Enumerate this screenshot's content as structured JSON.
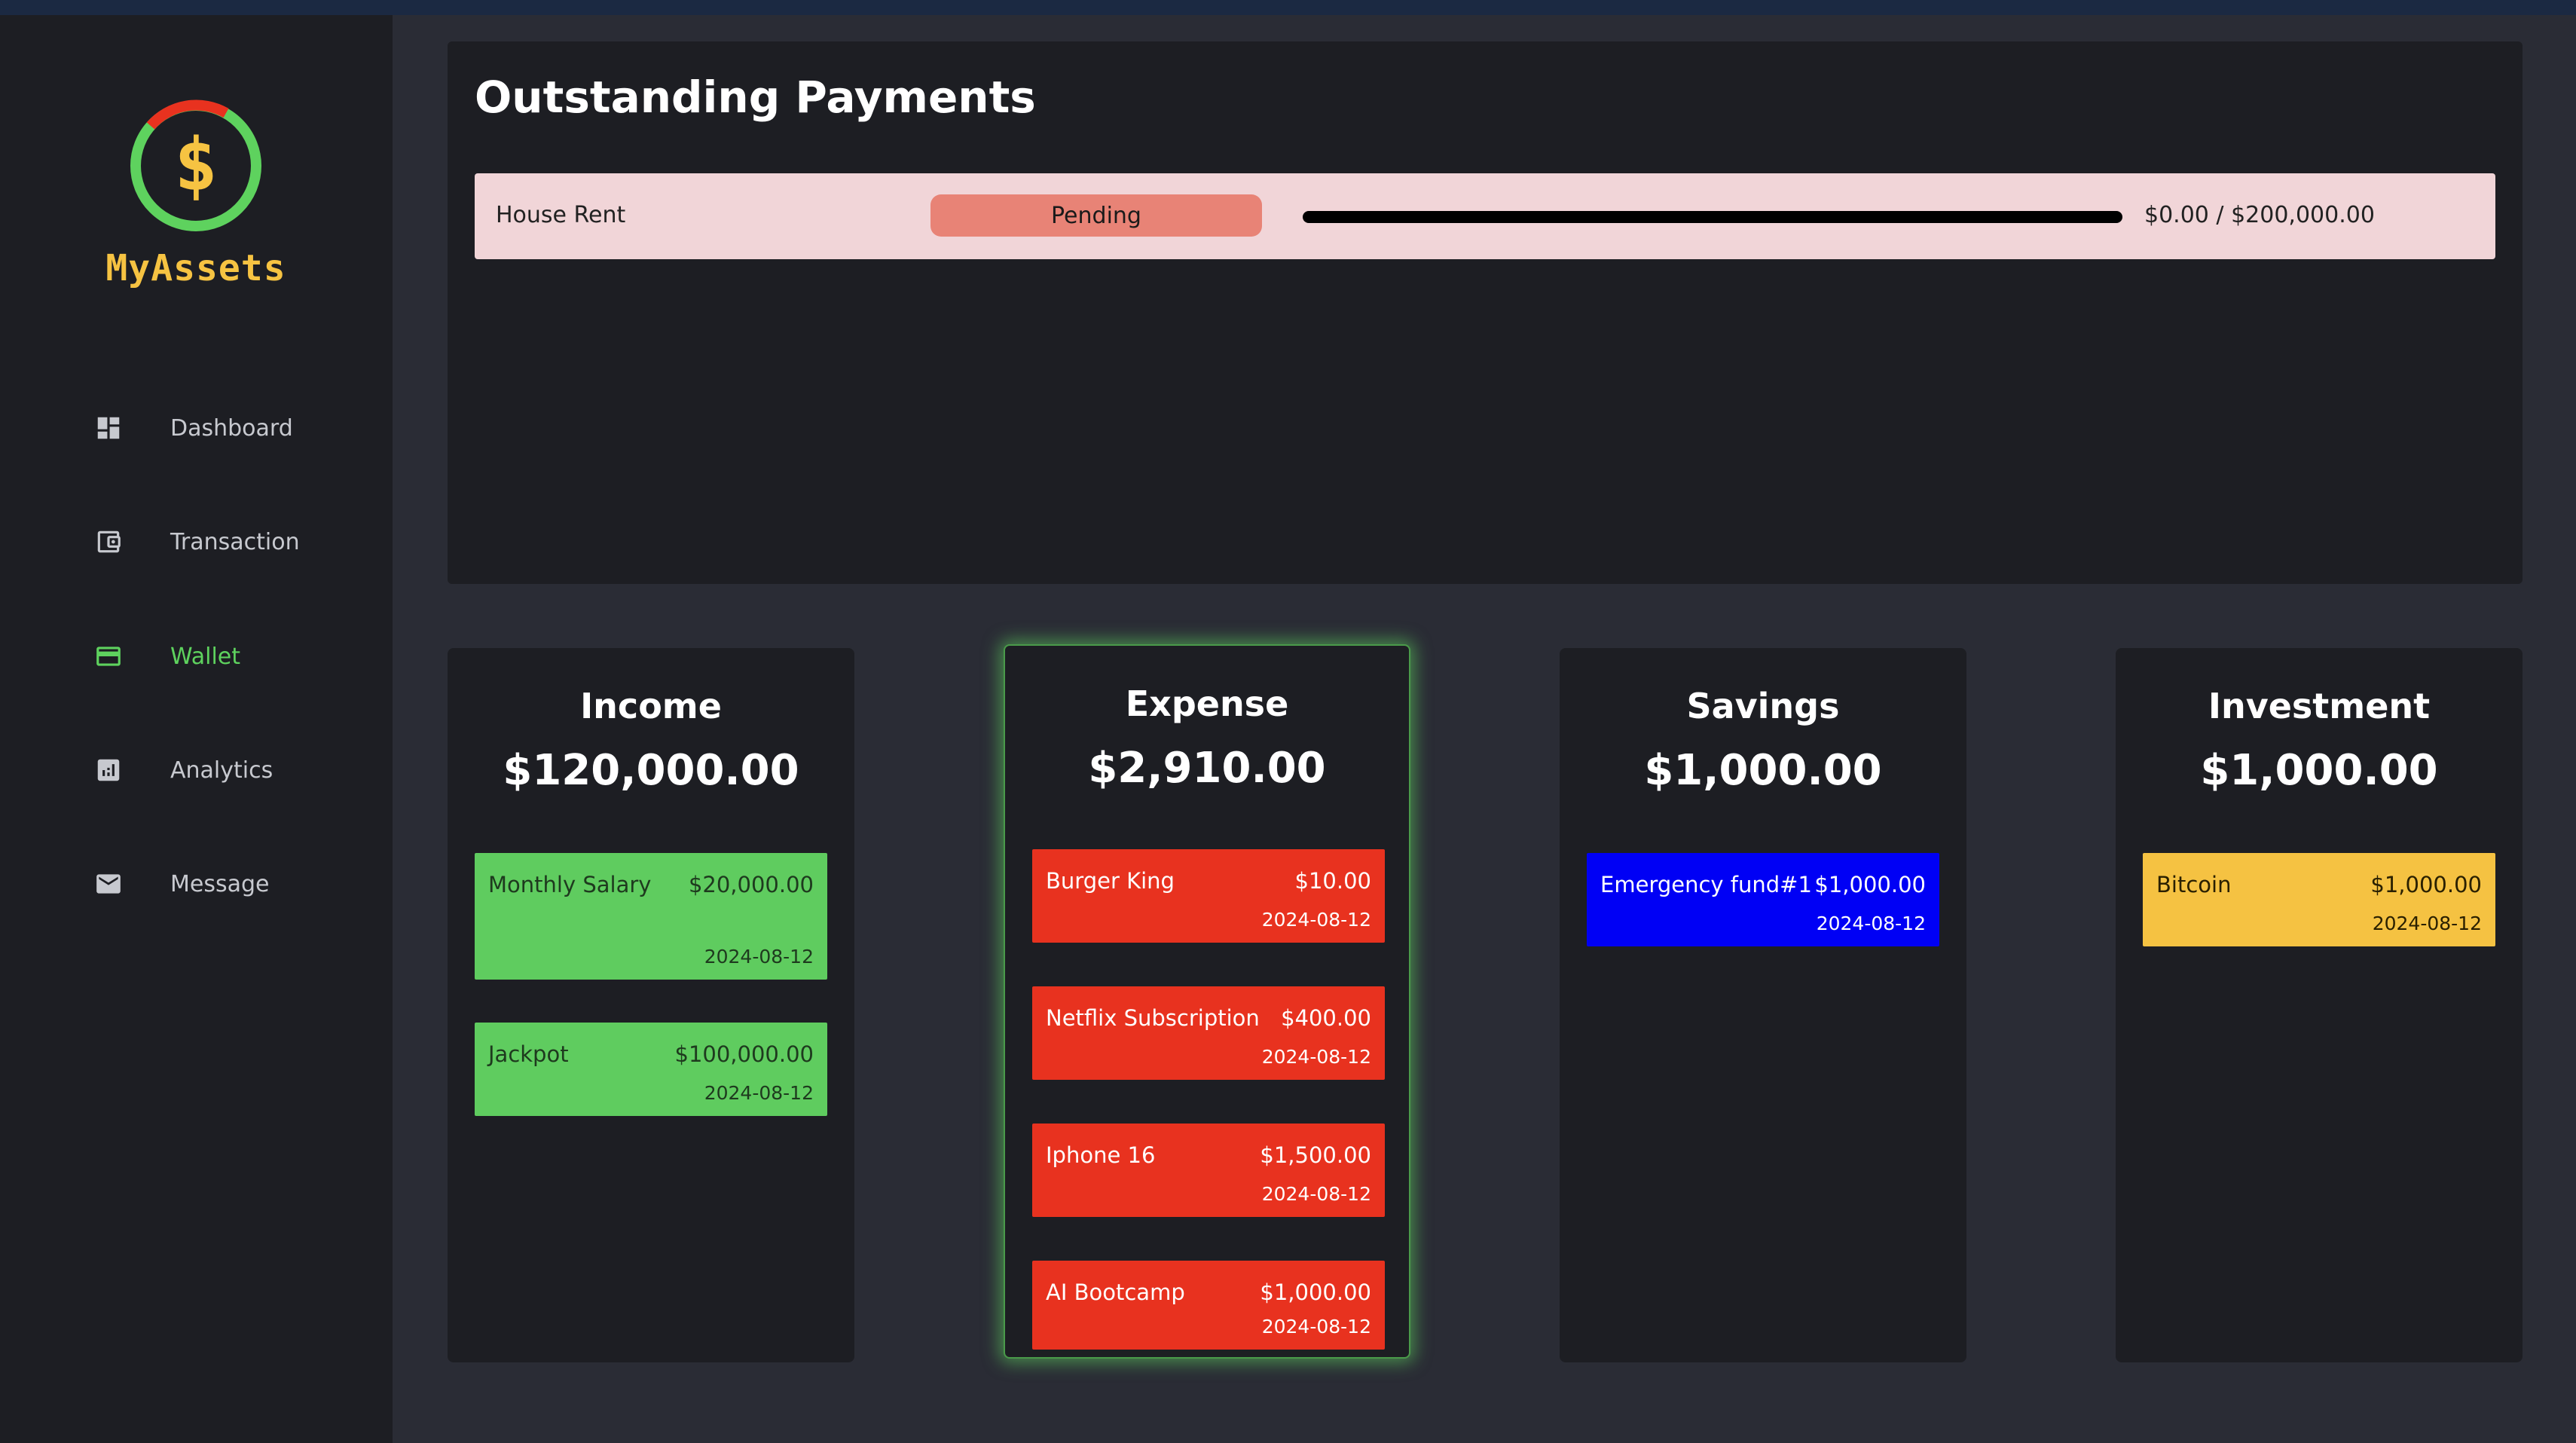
{
  "app": {
    "name": "MyAssets"
  },
  "colors": {
    "accent": "#5ed25e",
    "logo_gold": "#f6c342",
    "income": "#5fcc5f",
    "expense": "#e8321f",
    "savings": "#0000f5",
    "investment": "#f5c242",
    "pending": "#e88376"
  },
  "sidebar": {
    "items": [
      {
        "label": "Dashboard",
        "icon": "dashboard-icon",
        "active": false
      },
      {
        "label": "Transaction",
        "icon": "wallet-card-icon",
        "active": false
      },
      {
        "label": "Wallet",
        "icon": "credit-card-icon",
        "active": true
      },
      {
        "label": "Analytics",
        "icon": "bar-chart-icon",
        "active": false
      },
      {
        "label": "Message",
        "icon": "envelope-icon",
        "active": false
      }
    ]
  },
  "outstanding": {
    "title": "Outstanding Payments",
    "payments": [
      {
        "name": "House Rent",
        "status": "Pending",
        "amount_text": "$0.00 / $200,000.00",
        "progress_percent": 0
      }
    ]
  },
  "columns": {
    "income": {
      "title": "Income",
      "total": "$120,000.00",
      "items": [
        {
          "name": "Monthly Salary",
          "amount": "$20,000.00",
          "date": "2024-08-12"
        },
        {
          "name": "Jackpot",
          "amount": "$100,000.00",
          "date": "2024-08-12"
        }
      ]
    },
    "expense": {
      "title": "Expense",
      "total": "$2,910.00",
      "items": [
        {
          "name": "Burger King",
          "amount": "$10.00",
          "date": "2024-08-12"
        },
        {
          "name": "Netflix Subscription",
          "amount": "$400.00",
          "date": "2024-08-12"
        },
        {
          "name": "Iphone 16",
          "amount": "$1,500.00",
          "date": "2024-08-12"
        },
        {
          "name": "AI Bootcamp",
          "amount": "$1,000.00",
          "date": "2024-08-12"
        }
      ]
    },
    "savings": {
      "title": "Savings",
      "total": "$1,000.00",
      "items": [
        {
          "name": "Emergency fund#1",
          "amount": "$1,000.00",
          "date": "2024-08-12"
        }
      ]
    },
    "investment": {
      "title": "Investment",
      "total": "$1,000.00",
      "items": [
        {
          "name": "Bitcoin",
          "amount": "$1,000.00",
          "date": "2024-08-12"
        }
      ]
    }
  }
}
